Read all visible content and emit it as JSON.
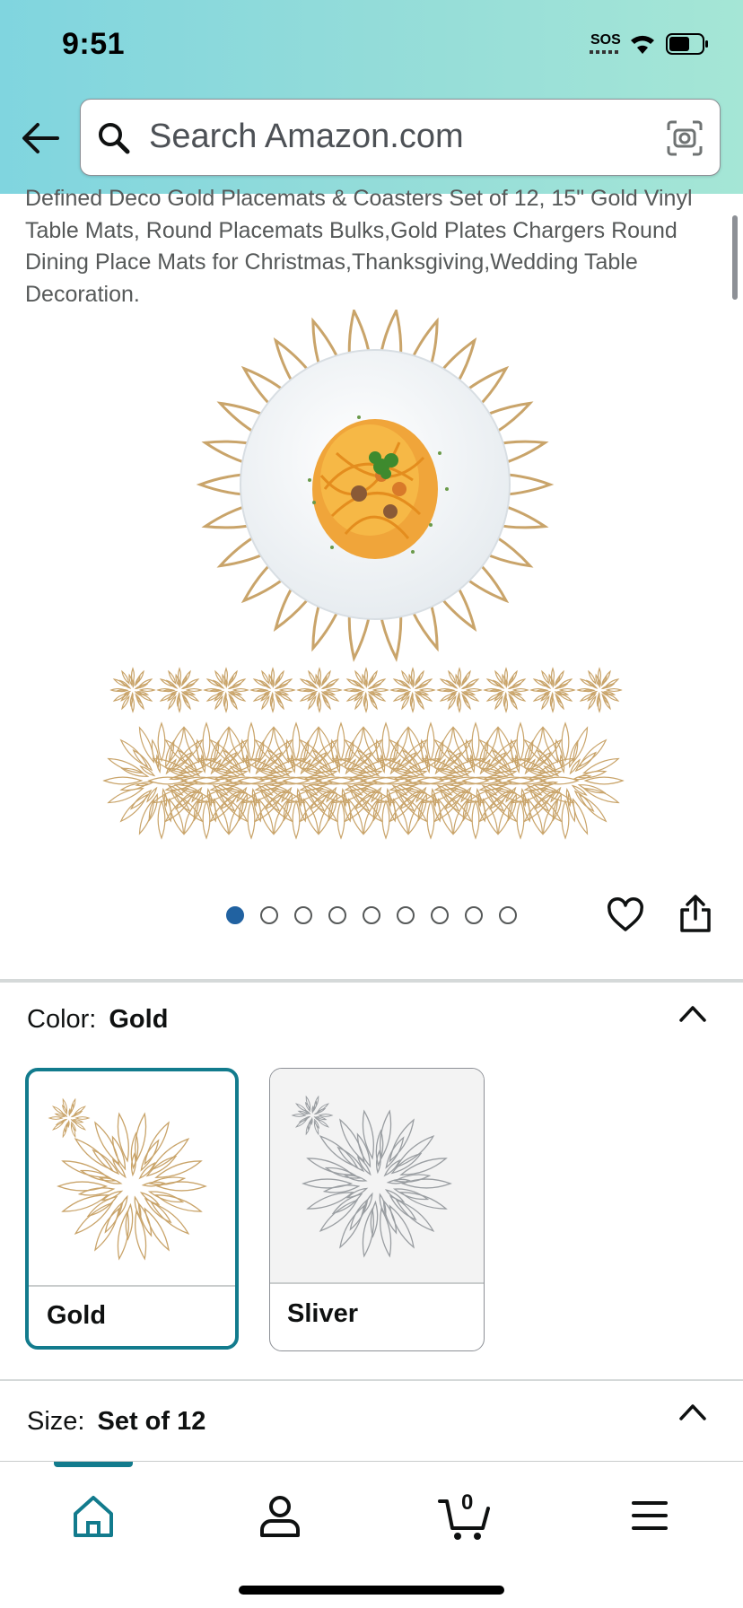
{
  "status_bar": {
    "time": "9:51",
    "sos": "SOS"
  },
  "search": {
    "placeholder": "Search Amazon.com"
  },
  "product": {
    "title": "Defined Deco Gold Placemats & Coasters Set of 12, 15\" Gold Vinyl Table Mats, Round Placemats Bulks,Gold Plates Chargers Round Dining Place Mats for Christmas,Thanksgiving,Wedding Table Decoration.",
    "image_count": 9,
    "active_image_index": 0
  },
  "color": {
    "label": "Color:",
    "selected": "Gold",
    "options": [
      {
        "name": "Gold",
        "selected": true
      },
      {
        "name": "Sliver",
        "selected": false
      }
    ]
  },
  "size": {
    "label": "Size:",
    "selected": "Set of 12"
  },
  "bottom_nav": {
    "cart_count": "0",
    "active": "home"
  },
  "colors": {
    "accent": "#127b8d",
    "dot_active": "#2162a1",
    "gold": "#c9a46a"
  }
}
